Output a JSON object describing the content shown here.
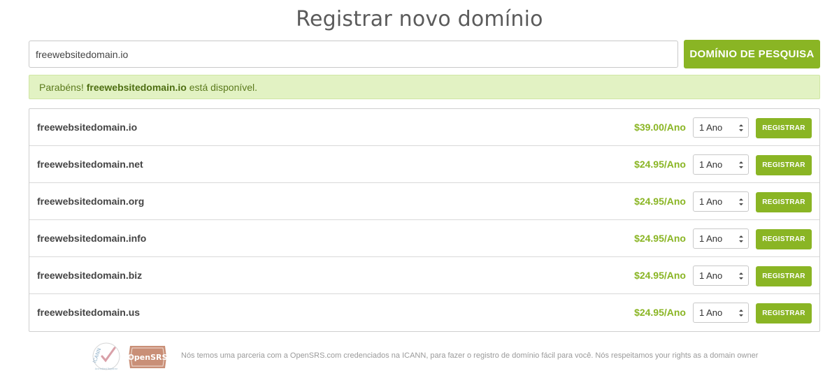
{
  "page": {
    "title": "Registrar novo domínio"
  },
  "search": {
    "value": "freewebsitedomain.io",
    "button_label": "DOMÍNIO DE PESQUISA"
  },
  "alert": {
    "prefix": "Parabéns! ",
    "domain": "freewebsitedomain.io",
    "suffix": " está disponível."
  },
  "results": [
    {
      "domain": "freewebsitedomain.io",
      "price": "$39.00/Ano",
      "period": "1 Ano",
      "button": "REGISTRAR"
    },
    {
      "domain": "freewebsitedomain.net",
      "price": "$24.95/Ano",
      "period": "1 Ano",
      "button": "REGISTRAR"
    },
    {
      "domain": "freewebsitedomain.org",
      "price": "$24.95/Ano",
      "period": "1 Ano",
      "button": "REGISTRAR"
    },
    {
      "domain": "freewebsitedomain.info",
      "price": "$24.95/Ano",
      "period": "1 Ano",
      "button": "REGISTRAR"
    },
    {
      "domain": "freewebsitedomain.biz",
      "price": "$24.95/Ano",
      "period": "1 Ano",
      "button": "REGISTRAR"
    },
    {
      "domain": "freewebsitedomain.us",
      "price": "$24.95/Ano",
      "period": "1 Ano",
      "button": "REGISTRAR"
    }
  ],
  "footer": {
    "text": "Nós temos uma parceria com a OpenSRS.com credenciados na ICANN, para fazer o registro de domínio fácil para você. Nós respeitamos your rights as a domain owner",
    "icann_logo_text": "ICANN",
    "icann_sub_text": "Accredited Registrar",
    "opensrs_logo_text": "OpenSRS",
    "icons": [
      "icann-accredited-logo",
      "opensrs-logo"
    ]
  },
  "colors": {
    "accent": "#8ab524",
    "alert_bg": "#e2f2c3",
    "alert_text": "#5b7a1c",
    "text": "#444444",
    "muted": "#9a9a9a"
  }
}
